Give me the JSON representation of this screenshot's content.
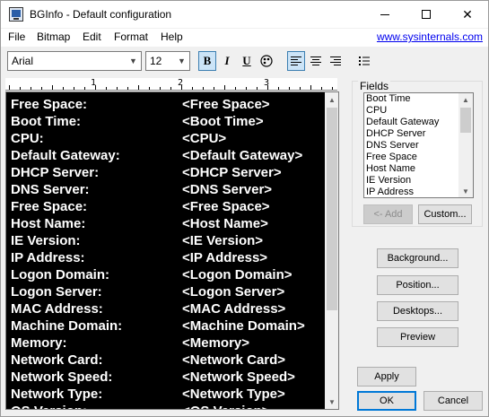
{
  "window": {
    "title": "BGInfo - Default configuration"
  },
  "menu": {
    "items": [
      "File",
      "Bitmap",
      "Edit",
      "Format",
      "Help"
    ],
    "link": "www.sysinternals.com"
  },
  "toolbar": {
    "font_name": "Arial",
    "font_size": "12",
    "bold": "B",
    "italic": "I",
    "underline": "U",
    "active_buttons": [
      "bold",
      "align-left"
    ]
  },
  "ruler": {
    "numbers": [
      "1",
      "2",
      "3"
    ]
  },
  "editor": {
    "rows": [
      {
        "label": "Free Space:",
        "value": "<Free Space>"
      },
      {
        "label": "Boot Time:",
        "value": "<Boot Time>"
      },
      {
        "label": "CPU:",
        "value": "<CPU>"
      },
      {
        "label": "Default Gateway:",
        "value": "<Default Gateway>"
      },
      {
        "label": "DHCP Server:",
        "value": "<DHCP Server>"
      },
      {
        "label": "DNS Server:",
        "value": "<DNS Server>"
      },
      {
        "label": "Free Space:",
        "value": "<Free Space>"
      },
      {
        "label": "Host Name:",
        "value": "<Host Name>"
      },
      {
        "label": "IE Version:",
        "value": "<IE Version>"
      },
      {
        "label": "IP Address:",
        "value": "<IP Address>"
      },
      {
        "label": "Logon Domain:",
        "value": "<Logon Domain>"
      },
      {
        "label": "Logon Server:",
        "value": "<Logon Server>"
      },
      {
        "label": "MAC Address:",
        "value": "<MAC Address>"
      },
      {
        "label": "Machine Domain:",
        "value": "<Machine Domain>"
      },
      {
        "label": "Memory:",
        "value": "<Memory>"
      },
      {
        "label": "Network Card:",
        "value": "<Network Card>"
      },
      {
        "label": "Network Speed:",
        "value": "<Network Speed>"
      },
      {
        "label": "Network Type:",
        "value": "<Network Type>"
      },
      {
        "label": "OS Version:",
        "value": "<OS Version>"
      }
    ],
    "background_color": "#000000",
    "text_color": "#ffffff"
  },
  "fields": {
    "legend": "Fields",
    "items": [
      "Boot Time",
      "CPU",
      "Default Gateway",
      "DHCP Server",
      "DNS Server",
      "Free Space",
      "Host Name",
      "IE Version",
      "IP Address"
    ],
    "add_label": "<- Add",
    "custom_label": "Custom..."
  },
  "buttons": {
    "background": "Background...",
    "position": "Position...",
    "desktops": "Desktops...",
    "preview": "Preview",
    "apply": "Apply",
    "ok": "OK",
    "cancel": "Cancel"
  },
  "colors": {
    "accent": "#0078d7",
    "link": "#0000ee",
    "active_tool": "#cce4f7"
  }
}
